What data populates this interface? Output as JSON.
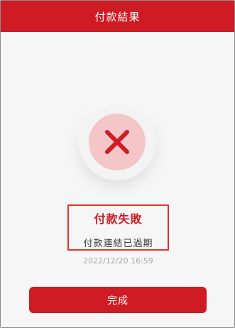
{
  "header": {
    "title": "付款結果"
  },
  "result": {
    "status_icon": "close-icon",
    "title": "付款失敗",
    "message": "付款連結已過期",
    "timestamp": "2022/12/20 16:59"
  },
  "actions": {
    "done_label": "完成"
  },
  "colors": {
    "brand": "#cf1b24",
    "highlight_border": "#e0352b",
    "icon_bg": "#f4c6c7"
  }
}
